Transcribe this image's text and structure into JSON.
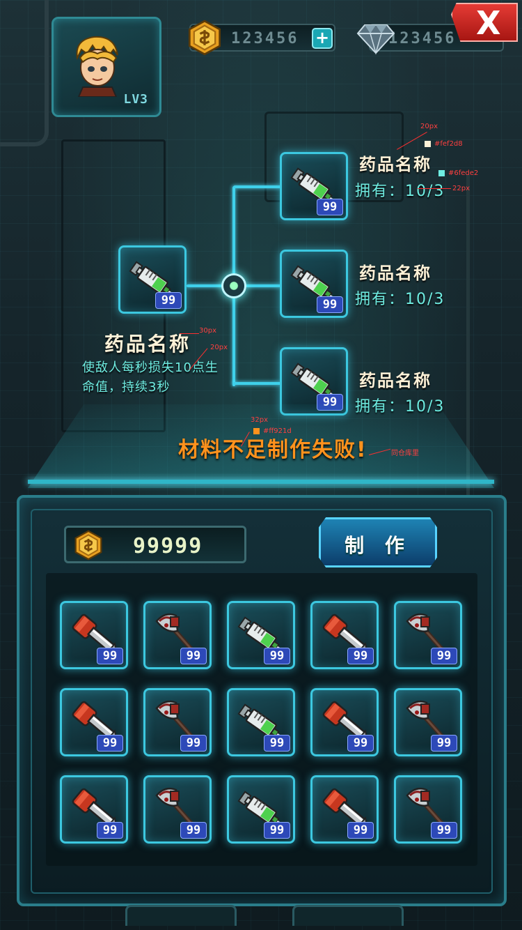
{
  "header": {
    "player_level": "LV3",
    "coins": "123456",
    "coins_add_label": "+",
    "diamonds": "123456",
    "close_label": "X"
  },
  "recipe": {
    "main": {
      "name": "药品名称",
      "count": "99",
      "description": "使敌人每秒损失10点生命值，持续3秒",
      "icon": "syringe-icon"
    },
    "materials": [
      {
        "name": "药品名称",
        "owned": "拥有：10/3",
        "count": "99",
        "icon": "syringe-icon"
      },
      {
        "name": "药品名称",
        "owned": "拥有：10/3",
        "count": "99",
        "icon": "syringe-icon"
      },
      {
        "name": "药品名称",
        "owned": "拥有：10/3",
        "count": "99",
        "icon": "syringe-icon"
      }
    ],
    "fail_message": "材料不足制作失败!"
  },
  "annotations": {
    "material_name_size": "20px",
    "material_name_color": "#fef2d8",
    "owned_color": "#6fede2",
    "owned_size": "22px",
    "main_name_size": "30px",
    "main_desc_size": "20px",
    "fail_size": "32px",
    "fail_color": "#ff921d",
    "font_note": "同仓库里"
  },
  "craft_panel": {
    "gold": "99999",
    "craft_button_label": "制 作"
  },
  "inventory": [
    {
      "icon": "wrench-icon",
      "count": "99"
    },
    {
      "icon": "axe-icon",
      "count": "99"
    },
    {
      "icon": "syringe-icon",
      "count": "99"
    },
    {
      "icon": "wrench-icon",
      "count": "99"
    },
    {
      "icon": "axe-icon",
      "count": "99"
    },
    {
      "icon": "wrench-icon",
      "count": "99"
    },
    {
      "icon": "axe-icon",
      "count": "99"
    },
    {
      "icon": "syringe-icon",
      "count": "99"
    },
    {
      "icon": "wrench-icon",
      "count": "99"
    },
    {
      "icon": "axe-icon",
      "count": "99"
    },
    {
      "icon": "wrench-icon",
      "count": "99"
    },
    {
      "icon": "axe-icon",
      "count": "99"
    },
    {
      "icon": "syringe-icon",
      "count": "99"
    },
    {
      "icon": "wrench-icon",
      "count": "99"
    },
    {
      "icon": "axe-icon",
      "count": "99"
    }
  ],
  "colors": {
    "accent_cyan": "#3cc8e0",
    "badge_blue": "#2d49b8",
    "fail_orange": "#ff921d",
    "close_red": "#e53b35"
  }
}
